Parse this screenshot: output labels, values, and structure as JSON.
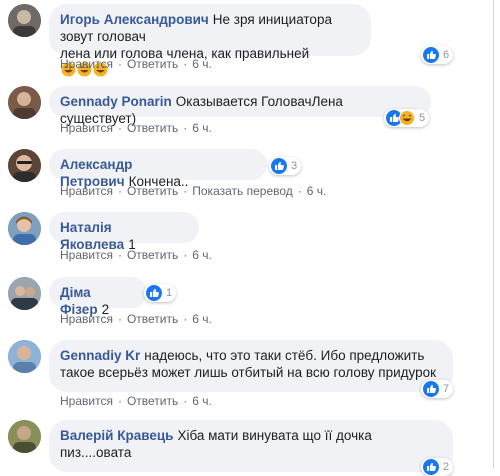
{
  "actions": {
    "like": "Нравится",
    "reply": "Ответить",
    "translate": "Показать перевод"
  },
  "comments": [
    {
      "author": "Игорь Александрович",
      "text_line1": "Не зря инициатора зовут головач",
      "text_line2": "лена или голова члена, как правильней",
      "time": "6 ч.",
      "reactions": "6"
    },
    {
      "author": "Gennady Ponarin",
      "text": "Оказывается ГоловачЛена существует)",
      "time": "6 ч.",
      "reactions": "5"
    },
    {
      "author": "Александр Петрович",
      "text": "Кончена..",
      "time": "6 ч.",
      "reactions": "3"
    },
    {
      "author": "Наталія Яковлева",
      "text": "1",
      "time": "6 ч."
    },
    {
      "author": "Діма Фізер",
      "text": "2",
      "time": "6 ч.",
      "reactions": "1"
    },
    {
      "author": "Gennadiy Kr",
      "text_line1": "надеюсь, что это таки стёб. Ибо предложить",
      "text_line2": "такое всерьёз может лишь отбитый на всю голову придурок",
      "time": "6 ч.",
      "reactions": "7"
    },
    {
      "author": "Валерій Кравець",
      "text_line1": "Хіба мати винувата що її дочка",
      "text_line2": "пиз....овата",
      "time": "6 ч.",
      "reactions": "2"
    }
  ],
  "colors": {
    "name": "#385898",
    "bubble": "#f0f2f5",
    "like_blue": "#1877f2",
    "haha_yellow": "#f7b125"
  }
}
